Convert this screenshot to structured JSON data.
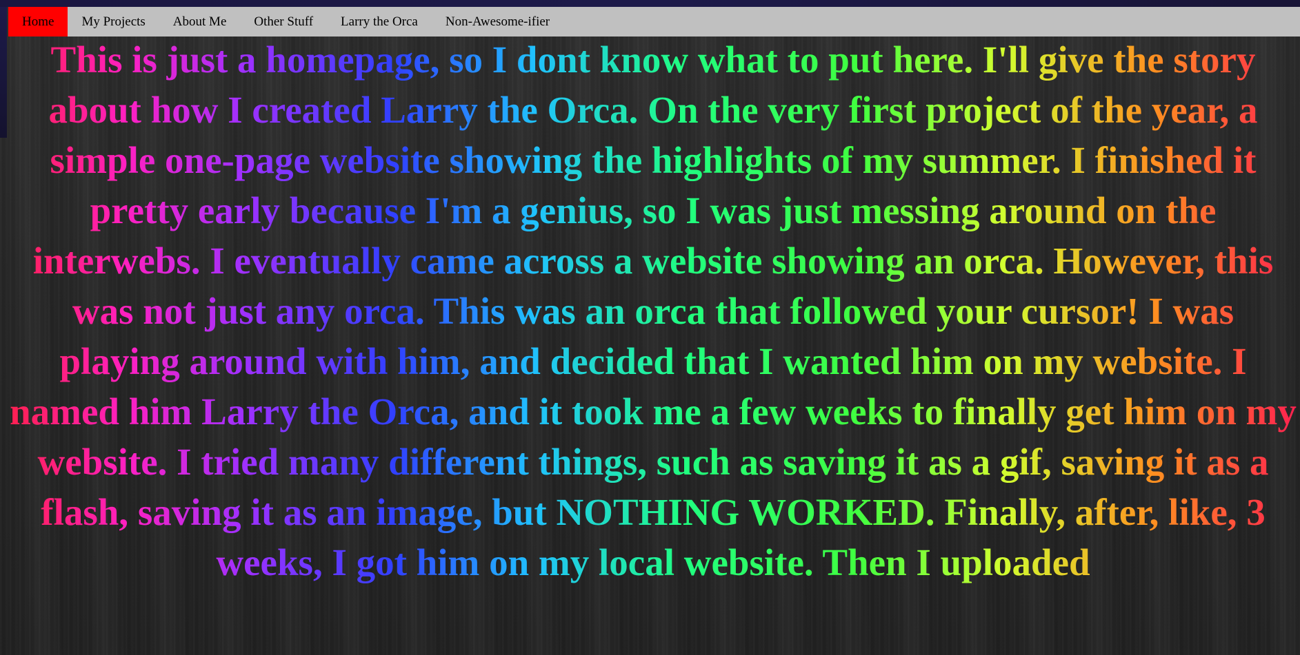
{
  "nav": {
    "items": [
      {
        "label": "Home",
        "active": true
      },
      {
        "label": "My Projects",
        "active": false
      },
      {
        "label": "About Me",
        "active": false
      },
      {
        "label": "Other Stuff",
        "active": false
      },
      {
        "label": "Larry the Orca",
        "active": false
      },
      {
        "label": "Non-Awesome-ifier",
        "active": false
      }
    ]
  },
  "main": {
    "story": "This is just a homepage, so I dont know what to put here. I'll give the story about how I created Larry the Orca. On the very first project of the year, a simple one-page website showing the highlights of my summer. I finished it pretty early because I'm a genius, so I was just messing around on the interwebs. I eventually came across a website showing an orca. However, this was not just any orca. This was an orca that followed your cursor! I was playing around with him, and decided that I wanted him on my website. I named him Larry the Orca, and it took me a few weeks to finally get him on my website. I tried many different things, such as saving it as a gif, saving it as a flash, saving it as an image, but NOTHING WORKED. Finally, after, like, 3 weeks, I got him on my local website. Then I uploaded"
  },
  "colors": {
    "nav_background": "#c0c0c0",
    "nav_active": "#ff0000",
    "page_background": "#262626",
    "top_strip": "#1d1a4a"
  }
}
